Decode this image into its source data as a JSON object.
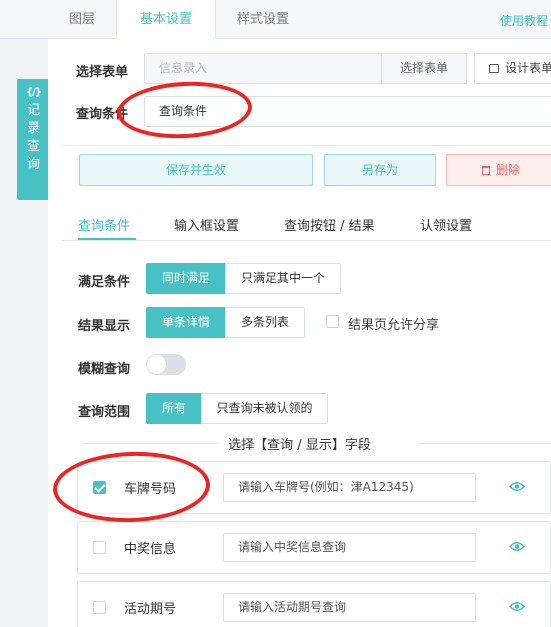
{
  "top_tabs": [
    "图层",
    "基本设置",
    "样式设置"
  ],
  "help_link": "使用教程",
  "sidebar": {
    "code_icon": "code-icon",
    "label": "记录查询"
  },
  "form_select": {
    "label": "选择表单",
    "value": "信息录入",
    "button": "选择表单",
    "design_button": "设计表单",
    "design_icon": "form-design-icon"
  },
  "query_condition": {
    "label": "查询条件",
    "value": "查询条件"
  },
  "actions": {
    "save": "保存并生效",
    "save_as": "另存为",
    "delete": "删除",
    "delete_icon": "trash-icon"
  },
  "sub_tabs": [
    "查询条件",
    "输入框设置",
    "查询按钮 / 结果",
    "认领设置"
  ],
  "match": {
    "label": "满足条件",
    "options": [
      "同时满足",
      "只满足其中一个"
    ],
    "selected": "同时满足"
  },
  "display": {
    "label": "结果显示",
    "options": [
      "单条详情",
      "多条列表"
    ],
    "selected": "单条详情",
    "share_label": "结果页允许分享",
    "share_checked": false
  },
  "fuzzy": {
    "label": "模糊查询",
    "enabled": false
  },
  "scope": {
    "label": "查询范围",
    "options": [
      "所有",
      "只查询未被认领的"
    ],
    "selected": "所有"
  },
  "fields_title": "选择【查询 / 显示】字段",
  "fields": [
    {
      "name": "车牌号码",
      "checked": true,
      "placeholder": "请输入车牌号(例如：津A12345)"
    },
    {
      "name": "中奖信息",
      "checked": false,
      "placeholder": "请输入中奖信息查询"
    },
    {
      "name": "活动期号",
      "checked": false,
      "placeholder": "请输入活动期号查询"
    }
  ],
  "eye_icon": "eye-icon",
  "colors": {
    "accent": "#47c1c4",
    "danger": "#ee6b6b",
    "annotation": "#ee2323"
  }
}
